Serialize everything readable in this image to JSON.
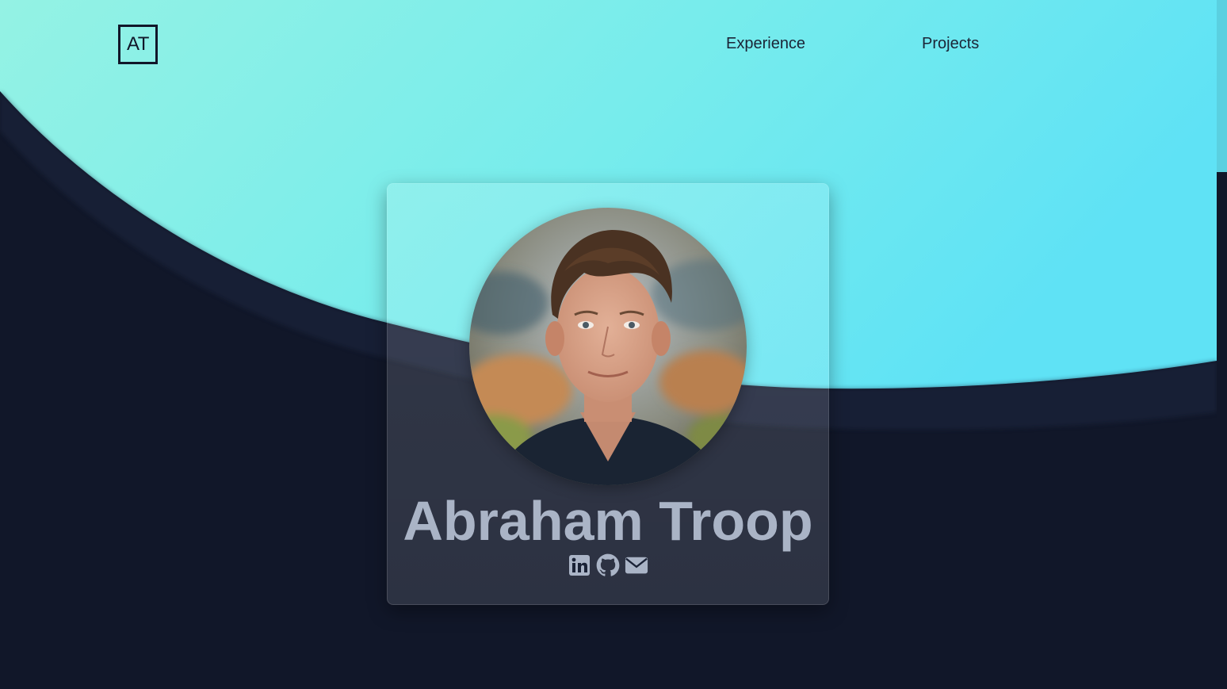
{
  "logo": {
    "text": "AT"
  },
  "nav": {
    "items": [
      {
        "label": "Experience"
      },
      {
        "label": "Projects"
      }
    ]
  },
  "profile": {
    "name": "Abraham Troop",
    "photo_icon": "profile-photo",
    "socials": [
      {
        "icon": "linkedin-icon"
      },
      {
        "icon": "github-icon"
      },
      {
        "icon": "email-icon"
      }
    ]
  },
  "colors": {
    "background_dark": "#111729",
    "wave_start": "#94f2e4",
    "wave_end": "#5fe2f5",
    "name_text": "#aab4c6",
    "icon": "#aab4c6"
  }
}
